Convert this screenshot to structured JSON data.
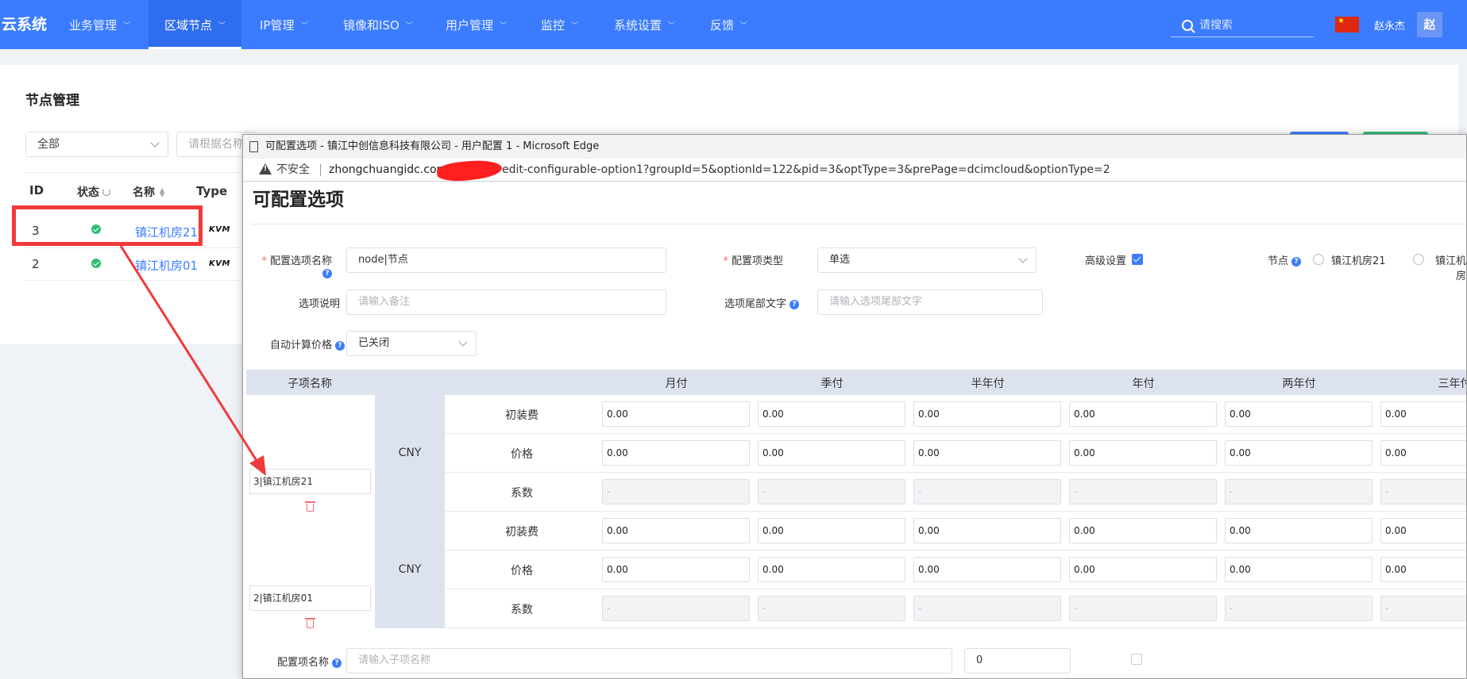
{
  "nav": {
    "brand": "云系统",
    "items": [
      "业务管理",
      "区域节点",
      "IP管理",
      "镜像和ISO",
      "用户管理",
      "监控",
      "系统设置",
      "反馈"
    ],
    "active_index": 1,
    "search_placeholder": "请搜索",
    "username": "赵永杰",
    "avatar_letter": "赵",
    "flag_color": "#de2910"
  },
  "page": {
    "title": "节点管理",
    "filter_select": "全部",
    "search_placeholder": "请根据名称",
    "columns": [
      "ID",
      "状态",
      "名称",
      "Type"
    ],
    "rows": [
      {
        "id": "3",
        "name": "镇江机房21",
        "type": "KVM"
      },
      {
        "id": "2",
        "name": "镇江机房01",
        "type": "KVM"
      }
    ]
  },
  "popup": {
    "window_title": "可配置选项 - 镇江中创信息科技有限公司 - 用户配置 1 - Microsoft Edge",
    "insecure_label": "不安全",
    "url_visible": "zhongchuangidc.com",
    "url_tail": "edit-configurable-option1?groupId=5&optionId=122&pid=3&optType=3&prePage=dcimcloud&optionType=2",
    "heading": "可配置选项",
    "form": {
      "option_name_label": "配置选项名称",
      "option_name_value": "node|节点",
      "option_type_label": "配置项类型",
      "option_type_value": "单选",
      "advanced_label": "高级设置",
      "node_label": "节点",
      "node_choices": [
        "镇江机房21",
        "镇江机房"
      ],
      "desc_label": "选项说明",
      "desc_placeholder": "请输入备注",
      "suffix_label": "选项尾部文字",
      "suffix_placeholder": "请输入选项尾部文字",
      "autoprice_label": "自动计算价格",
      "autoprice_value": "已关闭"
    },
    "table": {
      "sub_header": "子项名称",
      "periods": [
        "月付",
        "季付",
        "半年付",
        "年付",
        "两年付",
        "三年付"
      ],
      "currency": "CNY",
      "row_labels": [
        "初装费",
        "价格",
        "系数"
      ],
      "groups": [
        {
          "name": "3|镇江机房21",
          "setup": "0.00",
          "price": "0.00",
          "factor_ph": "-"
        },
        {
          "name": "2|镇江机房01",
          "setup": "0.00",
          "price": "0.00",
          "factor_ph": "-"
        }
      ]
    },
    "footer": {
      "label": "配置项名称",
      "placeholder": "请输入子项名称",
      "number_value": "0"
    }
  }
}
